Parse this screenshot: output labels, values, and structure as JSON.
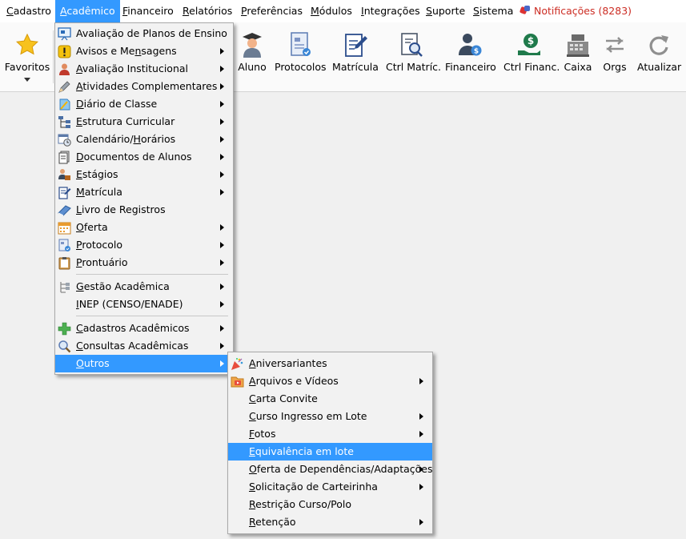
{
  "menubar": {
    "items": [
      {
        "label": "Cadastro",
        "accel": "C",
        "rest": "adastro"
      },
      {
        "label": "Acadêmico",
        "accel": "A",
        "rest": "cadêmico"
      },
      {
        "label": "Financeiro",
        "accel": "F",
        "rest": "inanceiro"
      },
      {
        "label": "Relatórios",
        "accel": "R",
        "rest": "elatórios"
      },
      {
        "label": "Preferências",
        "accel": "P",
        "rest": "referências"
      },
      {
        "label": "Módulos",
        "accel": "M",
        "rest": "ódulos"
      },
      {
        "label": "Integrações",
        "accel": "I",
        "rest": "ntegrações"
      },
      {
        "label": "Suporte",
        "accel": "S",
        "rest": "uporte"
      },
      {
        "label": "Sistema",
        "accel": "S",
        "rest": "istema"
      }
    ],
    "notifications": "Notificações (8283)"
  },
  "toolbar": {
    "favoritos": "Favoritos",
    "aluno": "Aluno",
    "protocolos": "Protocolos",
    "matricula": "Matrícula",
    "ctrl_matric": "Ctrl Matríc.",
    "financeiro": "Financeiro",
    "ctrl_financ": "Ctrl Financ.",
    "caixa": "Caixa",
    "orgs": "Orgs",
    "atualizar": "Atualizar"
  },
  "academico_menu": {
    "items": [
      {
        "pre": "",
        "accel": "",
        "post": "Avaliação de Planos de Ensino"
      },
      {
        "pre": "Avisos e Me",
        "accel": "n",
        "post": "sagens"
      },
      {
        "pre": "",
        "accel": "A",
        "post": "valiação Institucional"
      },
      {
        "pre": "",
        "accel": "A",
        "post": "tividades Complementares"
      },
      {
        "pre": "",
        "accel": "D",
        "post": "iário de Classe"
      },
      {
        "pre": "",
        "accel": "E",
        "post": "strutura Curricular"
      },
      {
        "pre": "Calendário/",
        "accel": "H",
        "post": "orários"
      },
      {
        "pre": "",
        "accel": "D",
        "post": "ocumentos de Alunos"
      },
      {
        "pre": "",
        "accel": "E",
        "post": "stágios"
      },
      {
        "pre": "",
        "accel": "M",
        "post": "atrícula"
      },
      {
        "pre": "",
        "accel": "L",
        "post": "ivro de Registros"
      },
      {
        "pre": "",
        "accel": "O",
        "post": "ferta"
      },
      {
        "pre": "",
        "accel": "P",
        "post": "rotocolo"
      },
      {
        "pre": "",
        "accel": "P",
        "post": "rontuário"
      },
      {
        "pre": "",
        "accel": "G",
        "post": "estão Acadêmica"
      },
      {
        "pre": "",
        "accel": "I",
        "post": "NEP (CENSO/ENADE)"
      },
      {
        "pre": "",
        "accel": "C",
        "post": "adastros Acadêmicos"
      },
      {
        "pre": "",
        "accel": "C",
        "post": "onsultas Acadêmicas"
      },
      {
        "pre": "",
        "accel": "O",
        "post": "utros"
      }
    ]
  },
  "outros_menu": {
    "items": [
      {
        "pre": "",
        "accel": "A",
        "post": "niversariantes"
      },
      {
        "pre": "",
        "accel": "A",
        "post": "rquivos e Vídeos"
      },
      {
        "pre": "",
        "accel": "C",
        "post": "arta Convite"
      },
      {
        "pre": "",
        "accel": "C",
        "post": "urso Ingresso em Lote"
      },
      {
        "pre": "",
        "accel": "F",
        "post": "otos"
      },
      {
        "pre": "",
        "accel": "E",
        "post": "quivalência em lote"
      },
      {
        "pre": "",
        "accel": "O",
        "post": "ferta de Dependências/Adaptações"
      },
      {
        "pre": "",
        "accel": "S",
        "post": "olicitação de Carteirinha"
      },
      {
        "pre": "",
        "accel": "R",
        "post": "estrição Curso/Polo"
      },
      {
        "pre": "",
        "accel": "R",
        "post": "etenção"
      }
    ]
  },
  "colors": {
    "highlight": "#3399ff",
    "notification": "#cc2c23",
    "menu_bg": "#f2f2f2"
  }
}
